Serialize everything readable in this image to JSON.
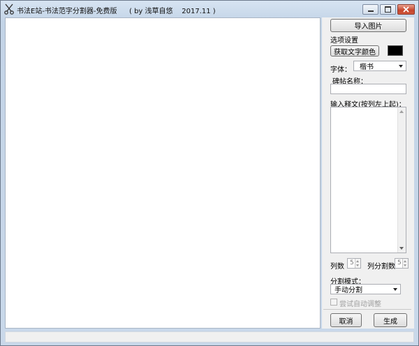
{
  "window": {
    "title": "书法E站-书法范字分割器-免费版",
    "subtitle": "( by 浅草自悠    2017.11 )"
  },
  "panel": {
    "import_button": "导入图片",
    "options_label": "选项设置",
    "get_color_button": "获取文字颜色",
    "text_color": "#000000",
    "font_label": "字体：",
    "font_value": "楷书",
    "stele_label": "碑帖名称：",
    "stele_value": "",
    "transcript_label": "输入释文(按列左上起)：",
    "transcript_value": "",
    "columns_label": "列数",
    "columns_value": "5",
    "col_split_label": "列分割数",
    "col_split_value": "5",
    "split_mode_label": "分割模式：",
    "split_mode_value": "手动分割",
    "auto_adjust_label": "尝试自动调整",
    "cancel_button": "取消",
    "generate_button": "生成"
  },
  "status": {
    "text": ""
  }
}
